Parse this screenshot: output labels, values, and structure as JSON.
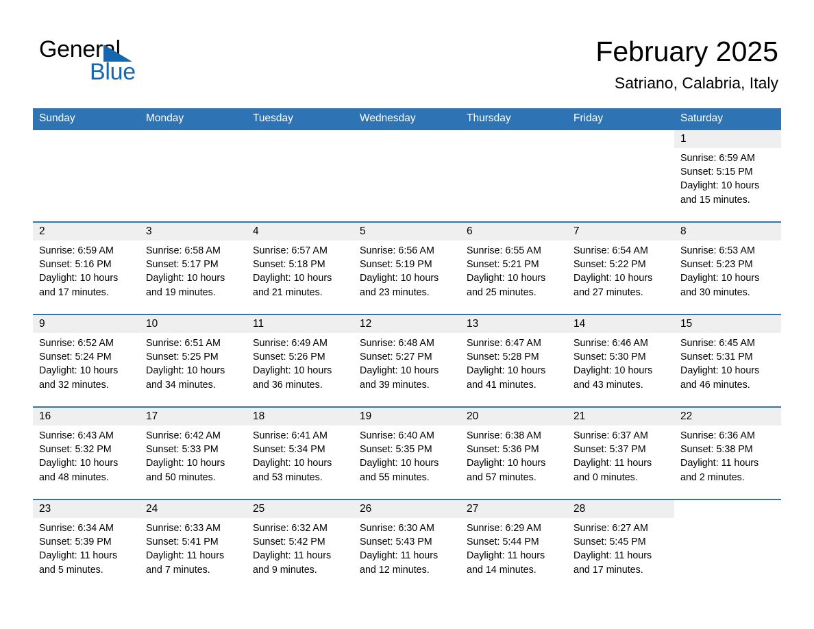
{
  "brand": {
    "name_part1": "General",
    "name_part2": "Blue"
  },
  "header": {
    "month_title": "February 2025",
    "location": "Satriano, Calabria, Italy"
  },
  "colors": {
    "header_blue": "#2e74b5",
    "brand_blue": "#1368b0",
    "daynum_band": "#efefef"
  },
  "weekday_headers": [
    "Sunday",
    "Monday",
    "Tuesday",
    "Wednesday",
    "Thursday",
    "Friday",
    "Saturday"
  ],
  "weeks": [
    {
      "days": [
        {
          "date": "",
          "sunrise": "",
          "sunset": "",
          "daylight_line1": "",
          "daylight_line2": "",
          "empty": true
        },
        {
          "date": "",
          "sunrise": "",
          "sunset": "",
          "daylight_line1": "",
          "daylight_line2": "",
          "empty": true
        },
        {
          "date": "",
          "sunrise": "",
          "sunset": "",
          "daylight_line1": "",
          "daylight_line2": "",
          "empty": true
        },
        {
          "date": "",
          "sunrise": "",
          "sunset": "",
          "daylight_line1": "",
          "daylight_line2": "",
          "empty": true
        },
        {
          "date": "",
          "sunrise": "",
          "sunset": "",
          "daylight_line1": "",
          "daylight_line2": "",
          "empty": true
        },
        {
          "date": "",
          "sunrise": "",
          "sunset": "",
          "daylight_line1": "",
          "daylight_line2": "",
          "empty": true
        },
        {
          "date": "1",
          "sunrise": "Sunrise: 6:59 AM",
          "sunset": "Sunset: 5:15 PM",
          "daylight_line1": "Daylight: 10 hours",
          "daylight_line2": "and 15 minutes.",
          "empty": false
        }
      ]
    },
    {
      "days": [
        {
          "date": "2",
          "sunrise": "Sunrise: 6:59 AM",
          "sunset": "Sunset: 5:16 PM",
          "daylight_line1": "Daylight: 10 hours",
          "daylight_line2": "and 17 minutes.",
          "empty": false
        },
        {
          "date": "3",
          "sunrise": "Sunrise: 6:58 AM",
          "sunset": "Sunset: 5:17 PM",
          "daylight_line1": "Daylight: 10 hours",
          "daylight_line2": "and 19 minutes.",
          "empty": false
        },
        {
          "date": "4",
          "sunrise": "Sunrise: 6:57 AM",
          "sunset": "Sunset: 5:18 PM",
          "daylight_line1": "Daylight: 10 hours",
          "daylight_line2": "and 21 minutes.",
          "empty": false
        },
        {
          "date": "5",
          "sunrise": "Sunrise: 6:56 AM",
          "sunset": "Sunset: 5:19 PM",
          "daylight_line1": "Daylight: 10 hours",
          "daylight_line2": "and 23 minutes.",
          "empty": false
        },
        {
          "date": "6",
          "sunrise": "Sunrise: 6:55 AM",
          "sunset": "Sunset: 5:21 PM",
          "daylight_line1": "Daylight: 10 hours",
          "daylight_line2": "and 25 minutes.",
          "empty": false
        },
        {
          "date": "7",
          "sunrise": "Sunrise: 6:54 AM",
          "sunset": "Sunset: 5:22 PM",
          "daylight_line1": "Daylight: 10 hours",
          "daylight_line2": "and 27 minutes.",
          "empty": false
        },
        {
          "date": "8",
          "sunrise": "Sunrise: 6:53 AM",
          "sunset": "Sunset: 5:23 PM",
          "daylight_line1": "Daylight: 10 hours",
          "daylight_line2": "and 30 minutes.",
          "empty": false
        }
      ]
    },
    {
      "days": [
        {
          "date": "9",
          "sunrise": "Sunrise: 6:52 AM",
          "sunset": "Sunset: 5:24 PM",
          "daylight_line1": "Daylight: 10 hours",
          "daylight_line2": "and 32 minutes.",
          "empty": false
        },
        {
          "date": "10",
          "sunrise": "Sunrise: 6:51 AM",
          "sunset": "Sunset: 5:25 PM",
          "daylight_line1": "Daylight: 10 hours",
          "daylight_line2": "and 34 minutes.",
          "empty": false
        },
        {
          "date": "11",
          "sunrise": "Sunrise: 6:49 AM",
          "sunset": "Sunset: 5:26 PM",
          "daylight_line1": "Daylight: 10 hours",
          "daylight_line2": "and 36 minutes.",
          "empty": false
        },
        {
          "date": "12",
          "sunrise": "Sunrise: 6:48 AM",
          "sunset": "Sunset: 5:27 PM",
          "daylight_line1": "Daylight: 10 hours",
          "daylight_line2": "and 39 minutes.",
          "empty": false
        },
        {
          "date": "13",
          "sunrise": "Sunrise: 6:47 AM",
          "sunset": "Sunset: 5:28 PM",
          "daylight_line1": "Daylight: 10 hours",
          "daylight_line2": "and 41 minutes.",
          "empty": false
        },
        {
          "date": "14",
          "sunrise": "Sunrise: 6:46 AM",
          "sunset": "Sunset: 5:30 PM",
          "daylight_line1": "Daylight: 10 hours",
          "daylight_line2": "and 43 minutes.",
          "empty": false
        },
        {
          "date": "15",
          "sunrise": "Sunrise: 6:45 AM",
          "sunset": "Sunset: 5:31 PM",
          "daylight_line1": "Daylight: 10 hours",
          "daylight_line2": "and 46 minutes.",
          "empty": false
        }
      ]
    },
    {
      "days": [
        {
          "date": "16",
          "sunrise": "Sunrise: 6:43 AM",
          "sunset": "Sunset: 5:32 PM",
          "daylight_line1": "Daylight: 10 hours",
          "daylight_line2": "and 48 minutes.",
          "empty": false
        },
        {
          "date": "17",
          "sunrise": "Sunrise: 6:42 AM",
          "sunset": "Sunset: 5:33 PM",
          "daylight_line1": "Daylight: 10 hours",
          "daylight_line2": "and 50 minutes.",
          "empty": false
        },
        {
          "date": "18",
          "sunrise": "Sunrise: 6:41 AM",
          "sunset": "Sunset: 5:34 PM",
          "daylight_line1": "Daylight: 10 hours",
          "daylight_line2": "and 53 minutes.",
          "empty": false
        },
        {
          "date": "19",
          "sunrise": "Sunrise: 6:40 AM",
          "sunset": "Sunset: 5:35 PM",
          "daylight_line1": "Daylight: 10 hours",
          "daylight_line2": "and 55 minutes.",
          "empty": false
        },
        {
          "date": "20",
          "sunrise": "Sunrise: 6:38 AM",
          "sunset": "Sunset: 5:36 PM",
          "daylight_line1": "Daylight: 10 hours",
          "daylight_line2": "and 57 minutes.",
          "empty": false
        },
        {
          "date": "21",
          "sunrise": "Sunrise: 6:37 AM",
          "sunset": "Sunset: 5:37 PM",
          "daylight_line1": "Daylight: 11 hours",
          "daylight_line2": "and 0 minutes.",
          "empty": false
        },
        {
          "date": "22",
          "sunrise": "Sunrise: 6:36 AM",
          "sunset": "Sunset: 5:38 PM",
          "daylight_line1": "Daylight: 11 hours",
          "daylight_line2": "and 2 minutes.",
          "empty": false
        }
      ]
    },
    {
      "days": [
        {
          "date": "23",
          "sunrise": "Sunrise: 6:34 AM",
          "sunset": "Sunset: 5:39 PM",
          "daylight_line1": "Daylight: 11 hours",
          "daylight_line2": "and 5 minutes.",
          "empty": false
        },
        {
          "date": "24",
          "sunrise": "Sunrise: 6:33 AM",
          "sunset": "Sunset: 5:41 PM",
          "daylight_line1": "Daylight: 11 hours",
          "daylight_line2": "and 7 minutes.",
          "empty": false
        },
        {
          "date": "25",
          "sunrise": "Sunrise: 6:32 AM",
          "sunset": "Sunset: 5:42 PM",
          "daylight_line1": "Daylight: 11 hours",
          "daylight_line2": "and 9 minutes.",
          "empty": false
        },
        {
          "date": "26",
          "sunrise": "Sunrise: 6:30 AM",
          "sunset": "Sunset: 5:43 PM",
          "daylight_line1": "Daylight: 11 hours",
          "daylight_line2": "and 12 minutes.",
          "empty": false
        },
        {
          "date": "27",
          "sunrise": "Sunrise: 6:29 AM",
          "sunset": "Sunset: 5:44 PM",
          "daylight_line1": "Daylight: 11 hours",
          "daylight_line2": "and 14 minutes.",
          "empty": false
        },
        {
          "date": "28",
          "sunrise": "Sunrise: 6:27 AM",
          "sunset": "Sunset: 5:45 PM",
          "daylight_line1": "Daylight: 11 hours",
          "daylight_line2": "and 17 minutes.",
          "empty": false
        },
        {
          "date": "",
          "sunrise": "",
          "sunset": "",
          "daylight_line1": "",
          "daylight_line2": "",
          "empty": true
        }
      ]
    }
  ]
}
